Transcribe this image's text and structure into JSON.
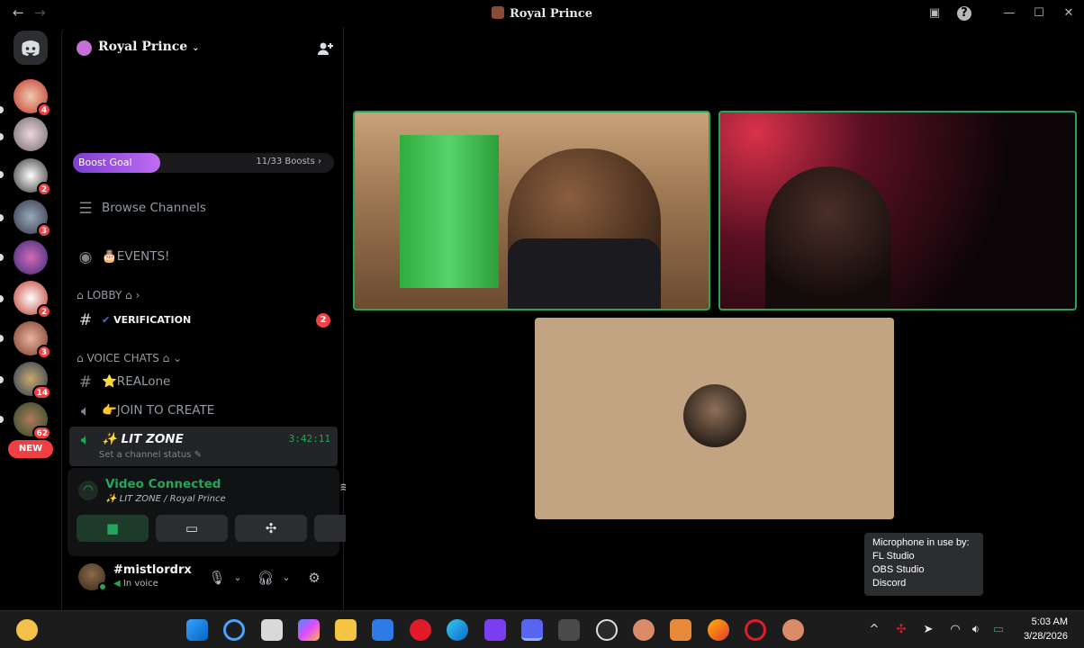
{
  "window": {
    "title": "Royal Prince"
  },
  "server": {
    "name": "Royal Prince",
    "boost": {
      "label": "Boost Goal",
      "count": "11/33 Boosts",
      "progress": 0.333
    }
  },
  "rail": {
    "badges": [
      "4",
      "2",
      "3",
      "2",
      "3",
      "14",
      "62"
    ],
    "new_label": "NEW"
  },
  "channels": {
    "browse": "Browse Channels",
    "events": "🎂EVENTS!",
    "cat_lobby": "LOBBY",
    "verification": "VERIFICATION",
    "verification_badge": "2",
    "cat_voice": "VOICE CHATS",
    "realone": "⭐REALone",
    "join_create": "👉JOIN TO CREATE",
    "lit_zone": "✨ LIT ZONE",
    "lit_status": "Set a channel status",
    "lit_timer": "3:42:11"
  },
  "voice_panel": {
    "title": "Video Connected",
    "subtitle": "✨ LIT ZONE / Royal Prince"
  },
  "user": {
    "name": "#mistlordrx",
    "status": "In voice"
  },
  "tooltip": {
    "heading": "Microphone in use by:",
    "apps": [
      "FL Studio",
      "OBS Studio",
      "Discord"
    ]
  },
  "clock": {
    "time": "5:03 AM",
    "date": "3/28/2026"
  },
  "colors": {
    "green": "#23a55a",
    "red": "#f23f43",
    "boost": "#a35ae6"
  }
}
